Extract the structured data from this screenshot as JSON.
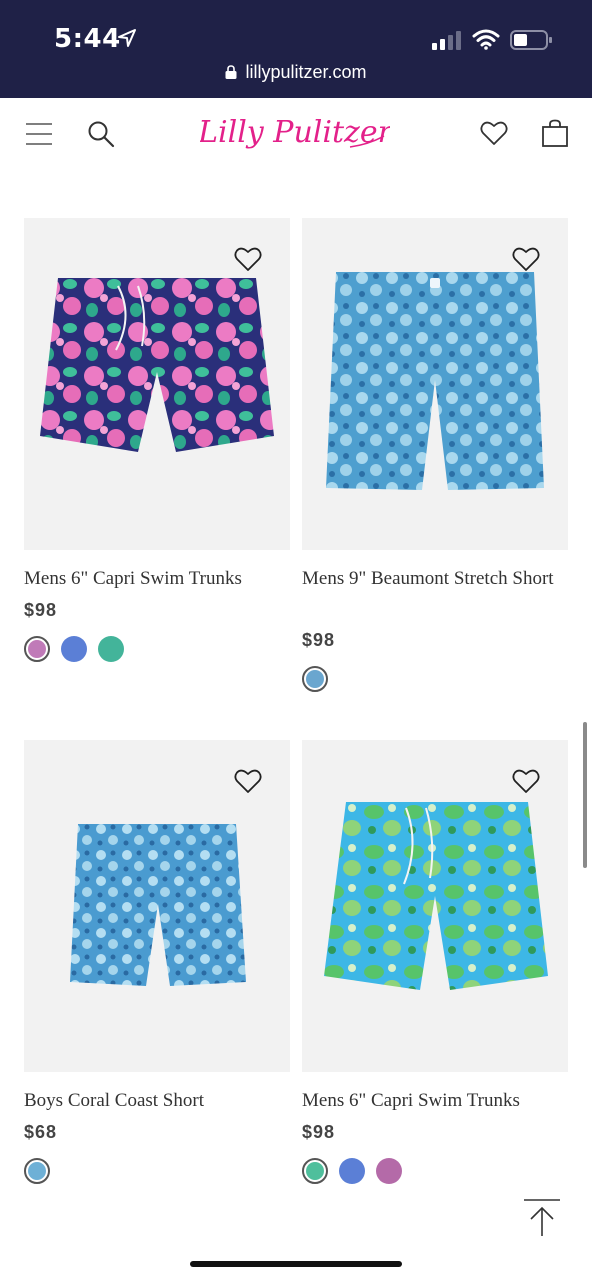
{
  "status_bar": {
    "time": "5:44",
    "url": "lillypulitzer.com",
    "background": "#1f2147"
  },
  "header": {
    "logo_text": "Lilly Pulitzer",
    "brand_color": "#e3218a",
    "icons": [
      "menu-icon",
      "search-icon",
      "heart-icon",
      "shopping-bag-icon"
    ]
  },
  "products": [
    {
      "name": "Mens 6\" Capri Swim Trunks",
      "price": "$98",
      "swatches": [
        {
          "color": "#c07ab8",
          "selected": true
        },
        {
          "color": "#5b7fd6",
          "selected": false
        },
        {
          "color": "#43b49a",
          "selected": false
        }
      ]
    },
    {
      "name": "Mens 9\" Beaumont Stretch Short",
      "price": "$98",
      "swatches": [
        {
          "color": "#6aa6cf",
          "selected": true
        }
      ]
    },
    {
      "name": "Boys Coral Coast Short",
      "price": "$68",
      "swatches": [
        {
          "color": "#6eb0d6",
          "selected": true
        }
      ]
    },
    {
      "name": "Mens 6\" Capri Swim Trunks",
      "price": "$98",
      "swatches": [
        {
          "color": "#4fbf9c",
          "selected": true
        },
        {
          "color": "#5b7fd6",
          "selected": false
        },
        {
          "color": "#b46aa8",
          "selected": false
        }
      ]
    }
  ],
  "back_to_top_icon": "arrow-up-icon"
}
